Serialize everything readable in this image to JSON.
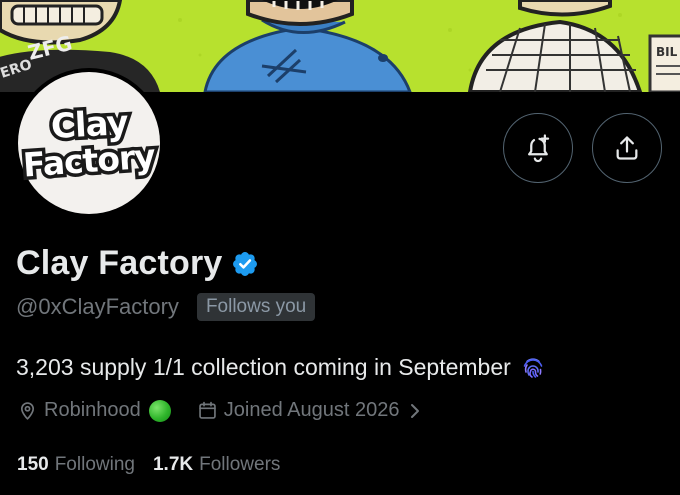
{
  "banner": {
    "sign_text_left": "ZFG",
    "sign_text_right": "BIL"
  },
  "avatar": {
    "line1": "Clay",
    "line2": "Factory"
  },
  "actions": {
    "notify_icon": "bell-plus-icon",
    "share_icon": "share-icon"
  },
  "profile": {
    "display_name": "Clay Factory",
    "verified_icon": "verified-badge-icon",
    "verified_color": "#1d9bf0",
    "handle": "@0xClayFactory",
    "follows_you": "Follows you",
    "bio": "3,203 supply 1/1 collection coming in September",
    "bio_emoji": "fingerprint-icon",
    "location": "Robinhood",
    "joined": "Joined August 2026"
  },
  "stats": {
    "following_count": "150",
    "following_label": "Following",
    "followers_count": "1.7K",
    "followers_label": "Followers"
  },
  "colors": {
    "background": "#000000",
    "primary_text": "#e7e9ea",
    "secondary_text": "#71767b",
    "banner_green": "#b4e02c",
    "badge_bg": "#2f3336"
  }
}
